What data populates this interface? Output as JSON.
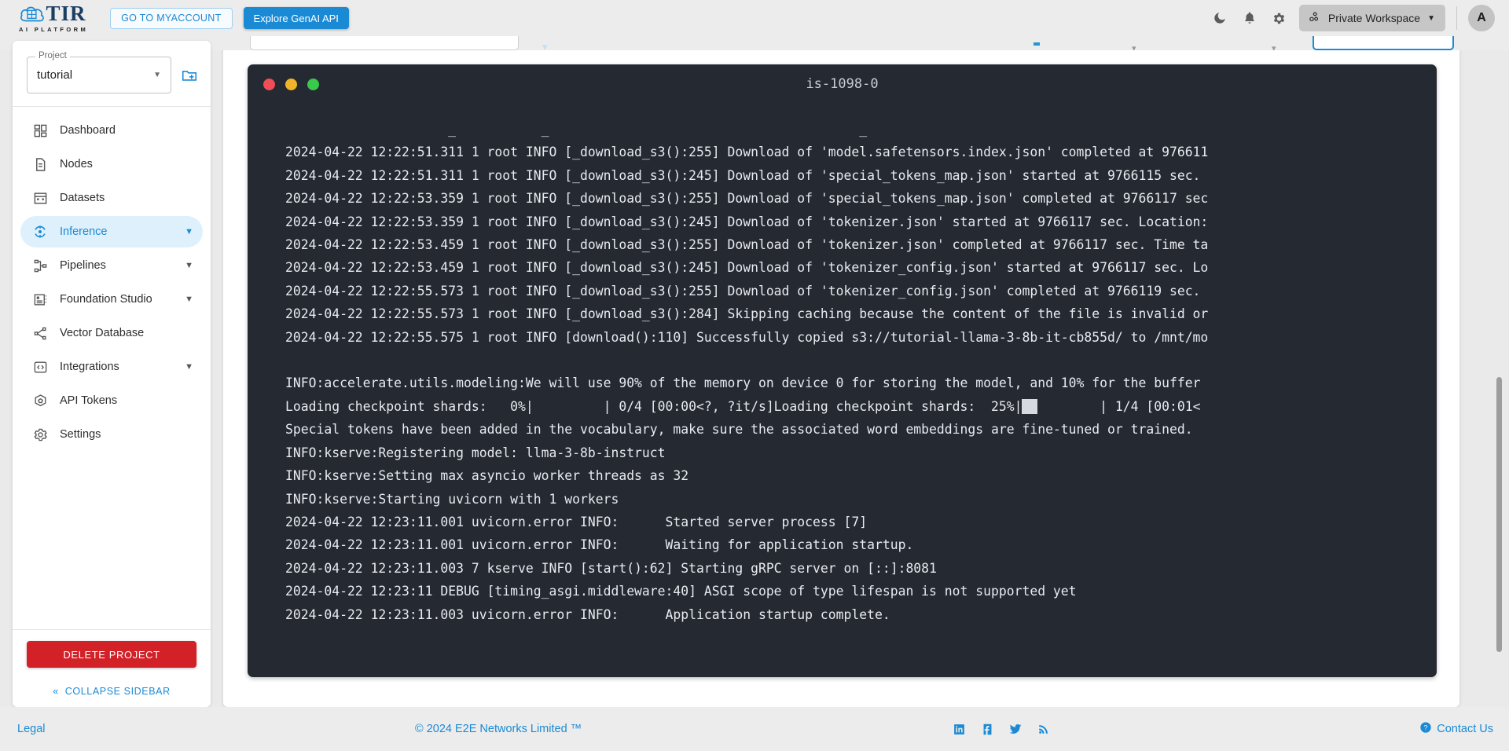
{
  "header": {
    "brand_name": "TIR",
    "brand_subtitle": "AI PLATFORM",
    "myaccount_label": "GO TO MYACCOUNT",
    "genai_label": "Explore GenAI API",
    "workspace_label": "Private Workspace",
    "avatar_initial": "A",
    "icons": {
      "dark_mode": "moon-icon",
      "notifications": "bell-icon",
      "settings": "gear-icon",
      "workspace": "workspace-icon",
      "caret": "chevron-down-icon"
    }
  },
  "sidebar": {
    "project_label": "Project",
    "project_value": "tutorial",
    "new_project_icon": "new-folder-icon",
    "items": [
      {
        "label": "Dashboard",
        "icon": "dashboard-icon",
        "expandable": false,
        "active": false
      },
      {
        "label": "Nodes",
        "icon": "document-icon",
        "expandable": false,
        "active": false
      },
      {
        "label": "Datasets",
        "icon": "grid-icon",
        "expandable": false,
        "active": false
      },
      {
        "label": "Inference",
        "icon": "inference-icon",
        "expandable": true,
        "active": true
      },
      {
        "label": "Pipelines",
        "icon": "pipeline-icon",
        "expandable": true,
        "active": false
      },
      {
        "label": "Foundation Studio",
        "icon": "foundation-icon",
        "expandable": true,
        "active": false
      },
      {
        "label": "Vector Database",
        "icon": "vector-database-icon",
        "expandable": false,
        "active": false
      },
      {
        "label": "Integrations",
        "icon": "code-brackets-icon",
        "expandable": true,
        "active": false
      },
      {
        "label": "API Tokens",
        "icon": "token-icon",
        "expandable": false,
        "active": false
      },
      {
        "label": "Settings",
        "icon": "gear-icon",
        "expandable": false,
        "active": false
      }
    ],
    "delete_label": "DELETE PROJECT",
    "collapse_label": "COLLAPSE SIDEBAR",
    "collapse_icon": "double-chevron-left-icon"
  },
  "terminal": {
    "title": "is-1098-0",
    "traffic_lights": [
      "close-red",
      "minimize-yellow",
      "maximize-green"
    ],
    "lines": [
      "                     _           _                                        _",
      "2024-04-22 12:22:51.311 1 root INFO [_download_s3():255] Download of 'model.safetensors.index.json' completed at 976611",
      "2024-04-22 12:22:51.311 1 root INFO [_download_s3():245] Download of 'special_tokens_map.json' started at 9766115 sec.",
      "2024-04-22 12:22:53.359 1 root INFO [_download_s3():255] Download of 'special_tokens_map.json' completed at 9766117 sec",
      "2024-04-22 12:22:53.359 1 root INFO [_download_s3():245] Download of 'tokenizer.json' started at 9766117 sec. Location:",
      "2024-04-22 12:22:53.459 1 root INFO [_download_s3():255] Download of 'tokenizer.json' completed at 9766117 sec. Time ta",
      "2024-04-22 12:22:53.459 1 root INFO [_download_s3():245] Download of 'tokenizer_config.json' started at 9766117 sec. Lo",
      "2024-04-22 12:22:55.573 1 root INFO [_download_s3():255] Download of 'tokenizer_config.json' completed at 9766119 sec. ",
      "2024-04-22 12:22:55.573 1 root INFO [_download_s3():284] Skipping caching because the content of the file is invalid or",
      "2024-04-22 12:22:55.575 1 root INFO [download():110] Successfully copied s3://tutorial-llama-3-8b-it-cb855d/ to /mnt/mo",
      "",
      "INFO:accelerate.utils.modeling:We will use 90% of the memory on device 0 for storing the model, and 10% for the buffer",
      "Special tokens have been added in the vocabulary, make sure the associated word embeddings are fine-tuned or trained.",
      "INFO:kserve:Registering model: llma-3-8b-instruct",
      "INFO:kserve:Setting max asyncio worker threads as 32",
      "INFO:kserve:Starting uvicorn with 1 workers",
      "2024-04-22 12:23:11.001 uvicorn.error INFO:      Started server process [7]",
      "2024-04-22 12:23:11.001 uvicorn.error INFO:      Waiting for application startup.",
      "2024-04-22 12:23:11.003 7 kserve INFO [start():62] Starting gRPC server on [::]:8081",
      "2024-04-22 12:23:11 DEBUG [timing_asgi.middleware:40] ASGI scope of type lifespan is not supported yet",
      "2024-04-22 12:23:11.003 uvicorn.error INFO:      Application startup complete."
    ],
    "progress_line": {
      "prefix": "Loading checkpoint shards:   0%|",
      "middle": "         | 0/4 [00:00<?, ?it/s]Loading checkpoint shards:  25%|",
      "bar": "██",
      "suffix": "        | 1/4 [00:01<"
    }
  },
  "footer": {
    "legal": "Legal",
    "copyright": "© 2024 E2E Networks Limited ™",
    "social": [
      "linkedin-icon",
      "facebook-icon",
      "twitter-icon",
      "rss-icon"
    ],
    "contact": "Contact Us",
    "contact_icon": "question-circle-icon"
  },
  "colors": {
    "accent": "#1a8ad5",
    "danger": "#d32128",
    "terminal_bg": "#242932",
    "header_bg": "#ececec"
  }
}
